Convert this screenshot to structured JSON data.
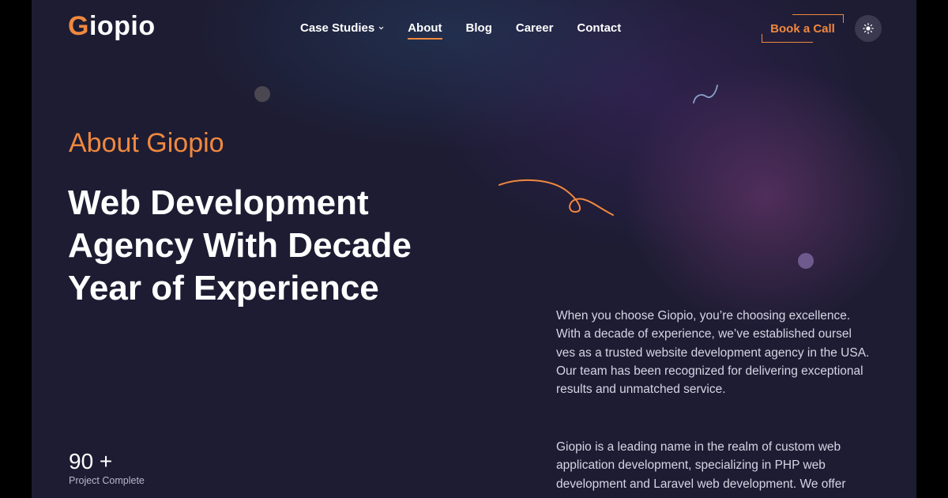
{
  "brand": {
    "initial": "G",
    "rest": "iopio"
  },
  "nav": {
    "items": [
      {
        "label": "Case Studies"
      },
      {
        "label": "About"
      },
      {
        "label": "Blog"
      },
      {
        "label": "Career"
      },
      {
        "label": "Contact"
      }
    ]
  },
  "header": {
    "cta_label": "Book a Call"
  },
  "hero": {
    "eyebrow": "About Giopio",
    "headline": "Web Development Agency With Decade Year of Experience"
  },
  "stat": {
    "value": "90 +",
    "label": "Project Complete"
  },
  "content": {
    "paragraph1": "When you choose Giopio, you’re choosing excellence. With a decade of experience, we’ve established oursel ves as a trusted website development agency in the USA. Our team has been recognized for delivering exceptional results and unmatched service.",
    "paragraph2": "Giopio is a leading name in the realm of custom web application development, specializing in PHP web development and Laravel web development. We offer"
  },
  "colors": {
    "accent": "#f0883e",
    "background": "#1d1c33",
    "text": "#ffffff"
  },
  "icons": {
    "dropdown": "chevron-down-icon",
    "theme": "sun-icon"
  }
}
